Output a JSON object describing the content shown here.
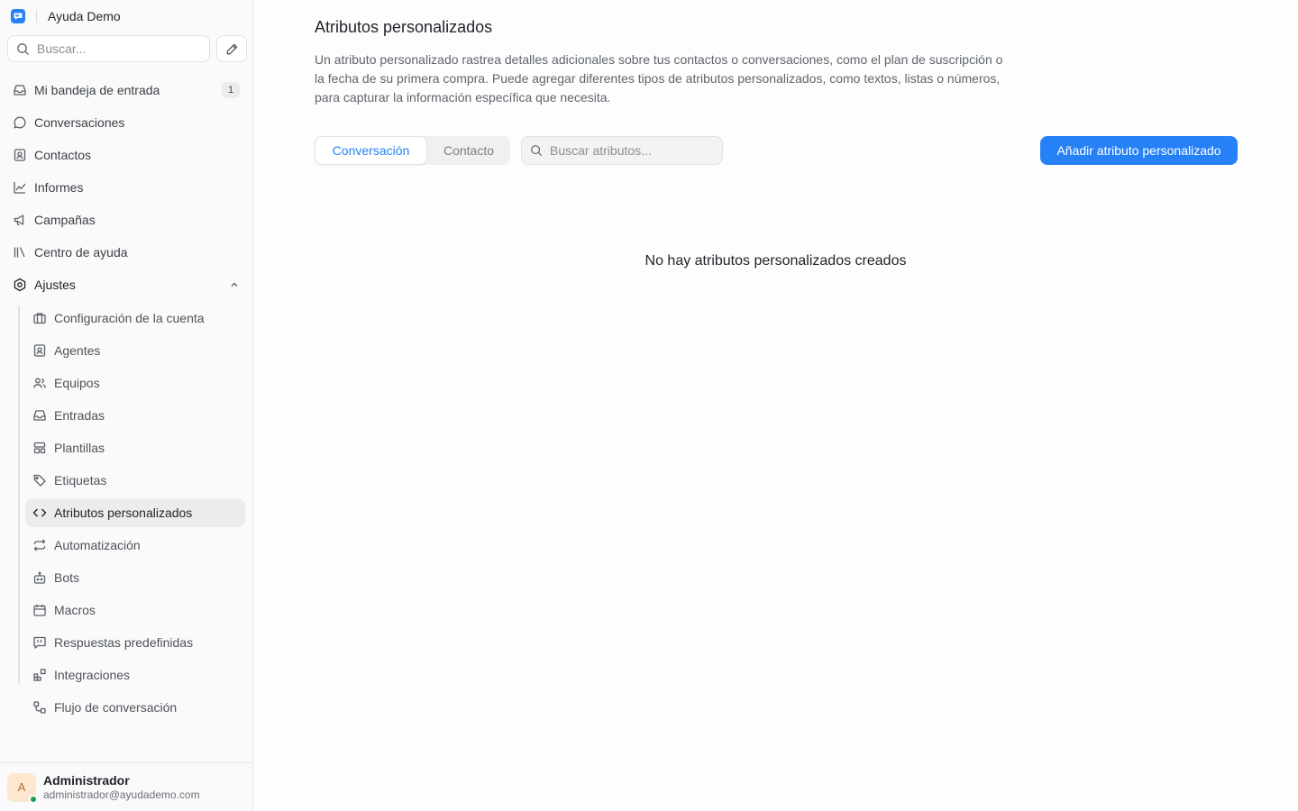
{
  "brand": {
    "name": "Ayuda Demo",
    "logo_icon": "chat-logo-icon",
    "accent": "#2781f6"
  },
  "sidebar": {
    "search_placeholder": "Buscar...",
    "items": [
      {
        "label": "Mi bandeja de entrada",
        "icon": "inbox-icon",
        "badge": "1"
      },
      {
        "label": "Conversaciones",
        "icon": "chat-bubble-icon"
      },
      {
        "label": "Contactos",
        "icon": "contact-card-icon"
      },
      {
        "label": "Informes",
        "icon": "chart-line-icon"
      },
      {
        "label": "Campañas",
        "icon": "megaphone-icon"
      },
      {
        "label": "Centro de ayuda",
        "icon": "library-icon"
      },
      {
        "label": "Ajustes",
        "icon": "settings-icon",
        "expanded": true
      }
    ],
    "settings_items": [
      {
        "label": "Configuración de la cuenta",
        "icon": "briefcase-icon"
      },
      {
        "label": "Agentes",
        "icon": "agent-icon"
      },
      {
        "label": "Equipos",
        "icon": "users-icon"
      },
      {
        "label": "Entradas",
        "icon": "inbox-icon"
      },
      {
        "label": "Plantillas",
        "icon": "template-icon"
      },
      {
        "label": "Etiquetas",
        "icon": "tag-icon"
      },
      {
        "label": "Atributos personalizados",
        "icon": "code-icon",
        "active": true
      },
      {
        "label": "Automatización",
        "icon": "repeat-icon"
      },
      {
        "label": "Bots",
        "icon": "bot-icon"
      },
      {
        "label": "Macros",
        "icon": "calendar-icon"
      },
      {
        "label": "Respuestas predefinidas",
        "icon": "quote-icon"
      },
      {
        "label": "Integraciones",
        "icon": "integrations-icon"
      },
      {
        "label": "Flujo de conversación",
        "icon": "flow-icon"
      }
    ]
  },
  "profile": {
    "initial": "A",
    "name": "Administrador",
    "email": "administrador@ayudademo.com",
    "status_color": "#18a058"
  },
  "main": {
    "title": "Atributos personalizados",
    "description": "Un atributo personalizado rastrea detalles adicionales sobre tus contactos o conversaciones, como el plan de suscripción o la fecha de su primera compra. Puede agregar diferentes tipos de atributos personalizados, como textos, listas o números, para capturar la información específica que necesita.",
    "tabs": [
      {
        "label": "Conversación",
        "active": true
      },
      {
        "label": "Contacto",
        "active": false
      }
    ],
    "search_placeholder": "Buscar atributos...",
    "add_button": "Añadir atributo personalizado",
    "empty_state": "No hay atributos personalizados creados"
  }
}
